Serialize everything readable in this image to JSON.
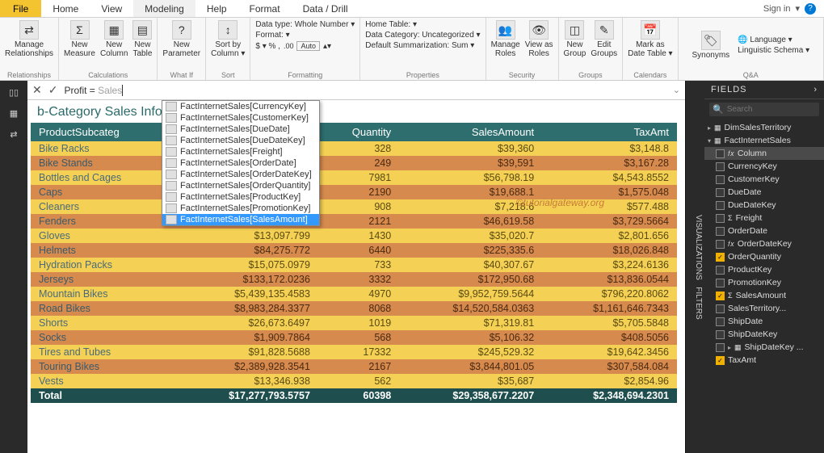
{
  "tabs": {
    "file": "File",
    "home": "Home",
    "view": "View",
    "modeling": "Modeling",
    "help": "Help",
    "format": "Format",
    "datadrill": "Data / Drill"
  },
  "signin": "Sign in",
  "ribbon": {
    "relationships": {
      "manage": "Manage\nRelationships",
      "group": "Relationships"
    },
    "calculations": {
      "measure": "New\nMeasure",
      "column": "New\nColumn",
      "table": "New\nTable",
      "group": "Calculations"
    },
    "whatif": {
      "param": "New\nParameter",
      "group": "What If"
    },
    "sort": {
      "sortby": "Sort by\nColumn ▾",
      "group": "Sort"
    },
    "formatting": {
      "datatype": "Data type: Whole Number ▾",
      "format": "Format: ▾",
      "currency": "$ ▾ % , ",
      "auto": "Auto",
      "group": "Formatting"
    },
    "properties": {
      "home": "Home Table: ▾",
      "category": "Data Category: Uncategorized ▾",
      "summar": "Default Summarization: Sum ▾",
      "group": "Properties"
    },
    "security": {
      "manage": "Manage\nRoles",
      "view": "View as\nRoles",
      "group": "Security"
    },
    "groups": {
      "new": "New\nGroup",
      "edit": "Edit\nGroups",
      "group": "Groups"
    },
    "calendars": {
      "mark": "Mark as\nDate Table ▾",
      "group": "Calendars"
    },
    "qa": {
      "syn": "Synonyms",
      "lang": "Language ▾",
      "ling": "Linguistic Schema ▾",
      "group": "Q&A"
    }
  },
  "formula": {
    "prefix": "Profit = ",
    "gray": "Sales"
  },
  "autocomplete": [
    "FactInternetSales[CurrencyKey]",
    "FactInternetSales[CustomerKey]",
    "FactInternetSales[DueDate]",
    "FactInternetSales[DueDateKey]",
    "FactInternetSales[Freight]",
    "FactInternetSales[OrderDate]",
    "FactInternetSales[OrderDateKey]",
    "FactInternetSales[OrderQuantity]",
    "FactInternetSales[ProductKey]",
    "FactInternetSales[PromotionKey]",
    "FactInternetSales[SalesAmount]"
  ],
  "autocomplete_selected": 10,
  "table_title": "b-Category Sales Information",
  "columns": [
    "ProductSubcateg",
    "",
    "Quantity",
    "SalesAmount",
    "TaxAmt"
  ],
  "rows": [
    {
      "c": "yellow",
      "v": [
        "Bike Racks",
        "",
        "328",
        "$39,360",
        "$3,148.8"
      ]
    },
    {
      "c": "orange",
      "v": [
        "Bike Stands",
        "",
        "249",
        "$39,591",
        "$3,167.28"
      ]
    },
    {
      "c": "yellow",
      "v": [
        "Bottles and Cages",
        "",
        "7981",
        "$56,798.19",
        "$4,543.8552"
      ]
    },
    {
      "c": "orange",
      "v": [
        "Caps",
        "",
        "2190",
        "$19,688.1",
        "$1,575.048"
      ]
    },
    {
      "c": "yellow",
      "v": [
        "Cleaners",
        "",
        "908",
        "$7,218.6",
        "$577.488"
      ]
    },
    {
      "c": "orange",
      "v": [
        "Fenders",
        "",
        "2121",
        "$46,619.58",
        "$3,729.5664"
      ]
    },
    {
      "c": "yellow",
      "v": [
        "Gloves",
        "$13,097.799",
        "1430",
        "$35,020.7",
        "$2,801.656"
      ]
    },
    {
      "c": "orange",
      "v": [
        "Helmets",
        "$84,275.772",
        "6440",
        "$225,335.6",
        "$18,026.848"
      ]
    },
    {
      "c": "yellow",
      "v": [
        "Hydration Packs",
        "$15,075.0979",
        "733",
        "$40,307.67",
        "$3,224.6136"
      ]
    },
    {
      "c": "orange",
      "v": [
        "Jerseys",
        "$133,172.0236",
        "3332",
        "$172,950.68",
        "$13,836.0544"
      ]
    },
    {
      "c": "yellow",
      "v": [
        "Mountain Bikes",
        "$5,439,135.4583",
        "4970",
        "$9,952,759.5644",
        "$796,220.8062"
      ]
    },
    {
      "c": "orange",
      "v": [
        "Road Bikes",
        "$8,983,284.3377",
        "8068",
        "$14,520,584.0363",
        "$1,161,646.7343"
      ]
    },
    {
      "c": "yellow",
      "v": [
        "Shorts",
        "$26,673.6497",
        "1019",
        "$71,319.81",
        "$5,705.5848"
      ]
    },
    {
      "c": "orange",
      "v": [
        "Socks",
        "$1,909.7864",
        "568",
        "$5,106.32",
        "$408.5056"
      ]
    },
    {
      "c": "yellow",
      "v": [
        "Tires and Tubes",
        "$91,828.5688",
        "17332",
        "$245,529.32",
        "$19,642.3456"
      ]
    },
    {
      "c": "orange",
      "v": [
        "Touring Bikes",
        "$2,389,928.3541",
        "2167",
        "$3,844,801.05",
        "$307,584.084"
      ]
    },
    {
      "c": "yellow",
      "v": [
        "Vests",
        "$13,346.938",
        "562",
        "$35,687",
        "$2,854.96"
      ]
    },
    {
      "c": "total",
      "v": [
        "Total",
        "$17,277,793.5757",
        "60398",
        "$29,358,677.2207",
        "$2,348,694.2301"
      ]
    }
  ],
  "fields": {
    "header": "FIELDS",
    "search": "Search",
    "tables": [
      {
        "name": "DimSalesTerritory",
        "expanded": false
      },
      {
        "name": "FactInternetSales",
        "expanded": true,
        "cols": [
          {
            "n": "Column",
            "chk": false,
            "hl": true,
            "icon": "fx"
          },
          {
            "n": "CurrencyKey",
            "chk": false
          },
          {
            "n": "CustomerKey",
            "chk": false
          },
          {
            "n": "DueDate",
            "chk": false
          },
          {
            "n": "DueDateKey",
            "chk": false
          },
          {
            "n": "Freight",
            "chk": false,
            "icon": "sum"
          },
          {
            "n": "OrderDate",
            "chk": false
          },
          {
            "n": "OrderDateKey",
            "chk": false,
            "icon": "fx"
          },
          {
            "n": "OrderQuantity",
            "chk": true
          },
          {
            "n": "ProductKey",
            "chk": false
          },
          {
            "n": "PromotionKey",
            "chk": false
          },
          {
            "n": "SalesAmount",
            "chk": true,
            "icon": "sum"
          },
          {
            "n": "SalesTerritory...",
            "chk": false
          },
          {
            "n": "ShipDate",
            "chk": false
          },
          {
            "n": "ShipDateKey",
            "chk": false
          },
          {
            "n": "ShipDateKey ...",
            "chk": false,
            "icon": "hier",
            "tri": true
          },
          {
            "n": "TaxAmt",
            "chk": true
          }
        ]
      }
    ]
  },
  "sidetabs": {
    "viz": "VISUALIZATIONS",
    "filters": "FILTERS"
  },
  "watermark": "©tutorialgateway.org"
}
